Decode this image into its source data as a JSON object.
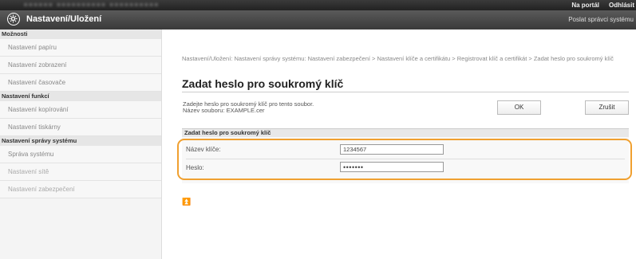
{
  "topbar": {
    "portal_label": "Na portál",
    "logout_label": "Odhlásit"
  },
  "header": {
    "title": "Nastavení/Uložení",
    "admin_link": "Poslat správci systému",
    "logo_icon": "settings-gear-icon"
  },
  "sidebar": {
    "sections": [
      {
        "heading": "Možnosti",
        "items": [
          "Nastavení papíru",
          "Nastavení zobrazení",
          "Nastavení časovače"
        ]
      },
      {
        "heading": "Nastavení funkcí",
        "items": [
          "Nastavení kopírování",
          "Nastavení tiskárny"
        ]
      },
      {
        "heading": "Nastavení správy systému",
        "items": [
          "Správa systému",
          "Nastavení sítě",
          "Nastavení zabezpečení"
        ]
      }
    ]
  },
  "main": {
    "breadcrumb": "Nastavení/Uložení: Nastavení správy systému: Nastavení zabezpečení > Nastavení klíče a certifikátu > Registrovat klíč a certifikát > Zadat heslo pro soukromý klíč",
    "page_title": "Zadat heslo pro soukromý klíč",
    "description_line1": "Zadejte heslo pro soukromý klíč pro tento soubor.",
    "description_line2": "Název souboru: EXAMPLE.cer",
    "ok_label": "OK",
    "cancel_label": "Zrušit",
    "section_title": "Zadat heslo pro soukromý klíč",
    "key_name_label": "Název klíče:",
    "key_name_value": "1234567",
    "password_label": "Heslo:",
    "password_value": "•••••••",
    "top_link_icon": "back-to-top-icon",
    "top_link_glyph": "⏫"
  }
}
